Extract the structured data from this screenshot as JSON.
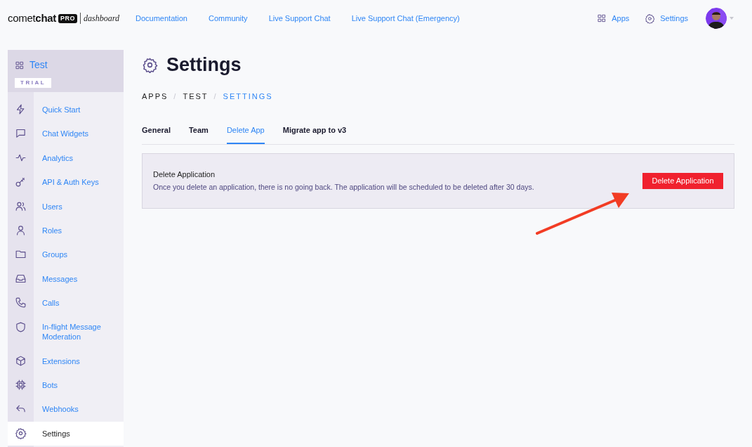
{
  "topbar": {
    "logo": {
      "wordmark_light": "comet",
      "wordmark_bold": "chat",
      "badge": "PRO",
      "subtitle": "dashboard"
    },
    "links": [
      "Documentation",
      "Community",
      "Live Support Chat",
      "Live Support Chat (Emergency)"
    ],
    "actions": [
      {
        "kind": "apps",
        "label": "Apps"
      },
      {
        "kind": "settings",
        "label": "Settings"
      }
    ]
  },
  "sidebar": {
    "app_name": "Test",
    "plan": "TRIAL",
    "items": [
      {
        "label": "Quick Start",
        "selected": false
      },
      {
        "label": "Chat Widgets",
        "selected": false
      },
      {
        "label": "Analytics",
        "selected": false
      },
      {
        "label": "API & Auth Keys",
        "selected": false
      },
      {
        "label": "Users",
        "selected": false
      },
      {
        "label": "Roles",
        "selected": false
      },
      {
        "label": "Groups",
        "selected": false
      },
      {
        "label": "Messages",
        "selected": false
      },
      {
        "label": "Calls",
        "selected": false
      },
      {
        "label": "In-flight Message Moderation",
        "selected": false
      },
      {
        "label": "Extensions",
        "selected": false
      },
      {
        "label": "Bots",
        "selected": false
      },
      {
        "label": "Webhooks",
        "selected": false
      },
      {
        "label": "Settings",
        "selected": true
      }
    ]
  },
  "page": {
    "title": "Settings",
    "breadcrumb_separator": "/",
    "breadcrumb": [
      {
        "label": "APPS",
        "current": false
      },
      {
        "label": "TEST",
        "current": false
      },
      {
        "label": "SETTINGS",
        "current": true
      }
    ],
    "tabs": [
      {
        "label": "General",
        "selected": false
      },
      {
        "label": "Team",
        "selected": false
      },
      {
        "label": "Delete App",
        "selected": true
      },
      {
        "label": "Migrate app to v3",
        "selected": false
      }
    ],
    "card": {
      "title": "Delete Application",
      "description": "Once you delete an application, there is no going back. The application will be scheduled to be deleted after 30 days.",
      "button": "Delete Application"
    },
    "annotations": [
      {
        "kind": "arrow"
      }
    ]
  }
}
